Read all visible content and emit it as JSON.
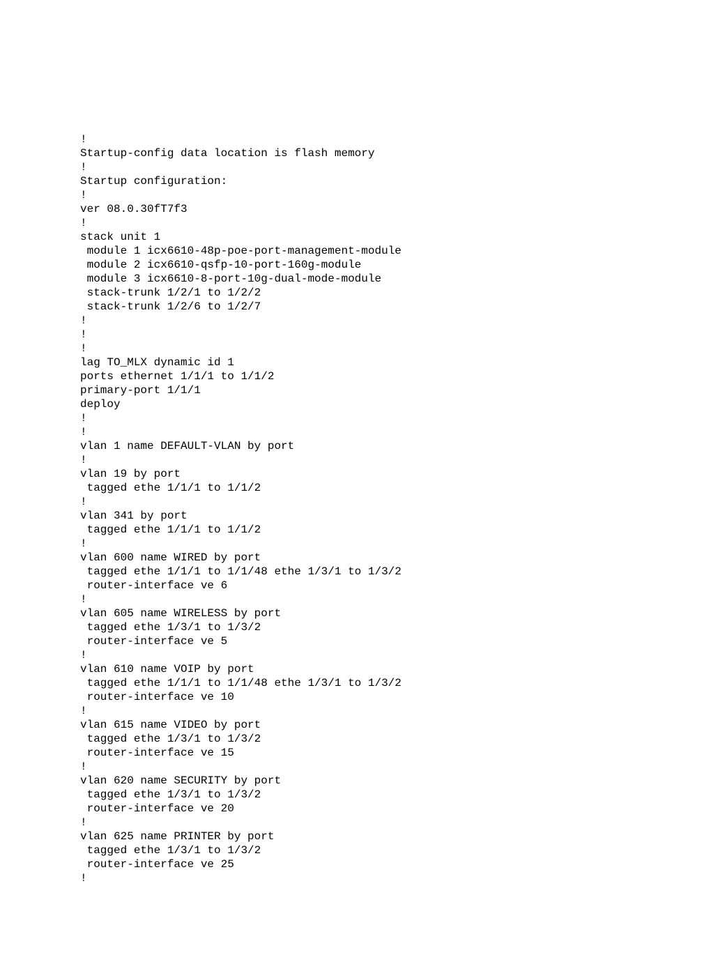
{
  "config": {
    "lines": [
      "!",
      "Startup-config data location is flash memory",
      "!",
      "Startup configuration:",
      "!",
      "ver 08.0.30fT7f3",
      "!",
      "stack unit 1",
      " module 1 icx6610-48p-poe-port-management-module",
      " module 2 icx6610-qsfp-10-port-160g-module",
      " module 3 icx6610-8-port-10g-dual-mode-module",
      " stack-trunk 1/2/1 to 1/2/2",
      " stack-trunk 1/2/6 to 1/2/7",
      "!",
      "!",
      "!",
      "lag TO_MLX dynamic id 1",
      "ports ethernet 1/1/1 to 1/1/2",
      "primary-port 1/1/1",
      "deploy",
      "!",
      "!",
      "vlan 1 name DEFAULT-VLAN by port",
      "!",
      "vlan 19 by port",
      " tagged ethe 1/1/1 to 1/1/2",
      "!",
      "vlan 341 by port",
      " tagged ethe 1/1/1 to 1/1/2",
      "!",
      "vlan 600 name WIRED by port",
      " tagged ethe 1/1/1 to 1/1/48 ethe 1/3/1 to 1/3/2",
      " router-interface ve 6",
      "!",
      "vlan 605 name WIRELESS by port",
      " tagged ethe 1/3/1 to 1/3/2",
      " router-interface ve 5",
      "!",
      "vlan 610 name VOIP by port",
      " tagged ethe 1/1/1 to 1/1/48 ethe 1/3/1 to 1/3/2",
      " router-interface ve 10",
      "!",
      "vlan 615 name VIDEO by port",
      " tagged ethe 1/3/1 to 1/3/2",
      " router-interface ve 15",
      "!",
      "vlan 620 name SECURITY by port",
      " tagged ethe 1/3/1 to 1/3/2",
      " router-interface ve 20",
      "!",
      "vlan 625 name PRINTER by port",
      " tagged ethe 1/3/1 to 1/3/2",
      " router-interface ve 25",
      "!"
    ]
  }
}
